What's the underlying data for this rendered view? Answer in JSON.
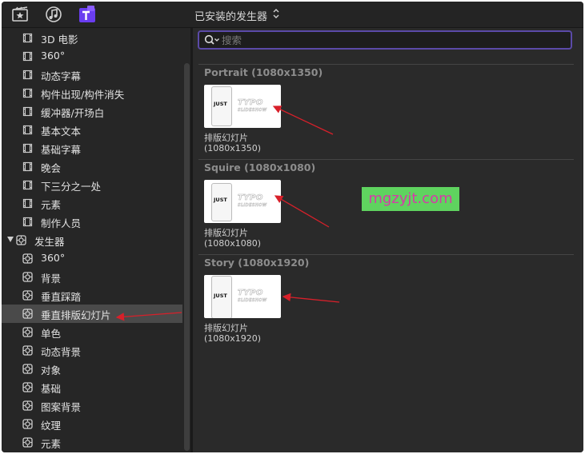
{
  "toolbar": {
    "title": "已安装的发生器",
    "icons": [
      "clapboard-star-icon",
      "music-note-icon",
      "titles-t-icon"
    ]
  },
  "sidebar": {
    "items": [
      {
        "label": "3D 电影",
        "icon": "film-frame-icon"
      },
      {
        "label": "360°",
        "icon": "film-frame-icon"
      },
      {
        "label": "动态字幕",
        "icon": "film-frame-icon"
      },
      {
        "label": "构件出现/构件消失",
        "icon": "film-frame-icon"
      },
      {
        "label": "缓冲器/开场白",
        "icon": "film-frame-icon"
      },
      {
        "label": "基本文本",
        "icon": "film-frame-icon"
      },
      {
        "label": "基础字幕",
        "icon": "film-frame-icon"
      },
      {
        "label": "晚会",
        "icon": "film-frame-icon"
      },
      {
        "label": "下三分之一处",
        "icon": "film-frame-icon"
      },
      {
        "label": "元素",
        "icon": "film-frame-icon"
      },
      {
        "label": "制作人员",
        "icon": "film-frame-icon"
      }
    ],
    "generators": {
      "label": "发生器",
      "icon": "generator-icon",
      "items": [
        {
          "label": "360°"
        },
        {
          "label": "背景"
        },
        {
          "label": "垂直踩踏"
        },
        {
          "label": "垂直排版幻灯片",
          "selected": true
        },
        {
          "label": "单色"
        },
        {
          "label": "动态背景"
        },
        {
          "label": "对象"
        },
        {
          "label": "基础"
        },
        {
          "label": "图案背景"
        },
        {
          "label": "纹理"
        },
        {
          "label": "元素"
        }
      ]
    }
  },
  "search": {
    "placeholder": "搜索",
    "value": ""
  },
  "sections": [
    {
      "title": "Portrait (1080x1350)",
      "item": {
        "name": "排版幻灯片",
        "size": "(1080x1350)",
        "just": "JUST",
        "typo": "TYPO",
        "sub": "SLIDESHOW"
      }
    },
    {
      "title": "Squire (1080x1080)",
      "item": {
        "name": "排版幻灯片",
        "size": "(1080x1080)",
        "just": "JUST",
        "typo": "TYPO",
        "sub": "SLIDESHOW"
      }
    },
    {
      "title": "Story (1080x1920)",
      "item": {
        "name": "排版幻灯片",
        "size": "(1080x1920)",
        "just": "JUST",
        "typo": "TYPO",
        "sub": "SLIDESHOW"
      }
    }
  ],
  "watermark": "mgzyjt.com",
  "colors": {
    "accent": "#5b4aa8",
    "annotation_arrow": "#d8202a",
    "watermark_bg": "#5fd35f",
    "watermark_text": "#d63aa8"
  }
}
